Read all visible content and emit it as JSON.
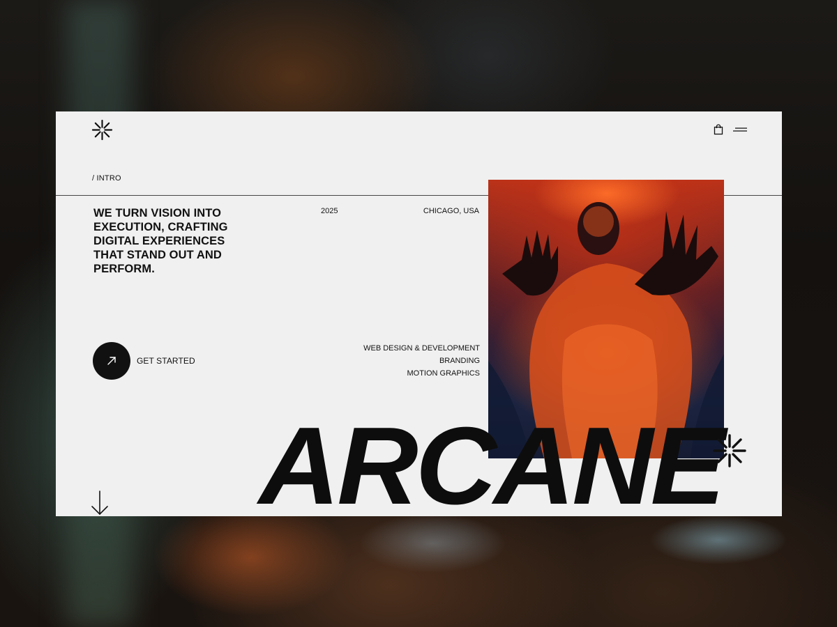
{
  "section_label": "/ INTRO",
  "headline": "WE TURN VISION INTO EXECUTION, CRAFTING DIGITAL EXPERIENCES THAT STAND OUT AND PERFORM.",
  "meta": {
    "year": "2025",
    "location": "CHICAGO, USA"
  },
  "services": [
    "WEB DESIGN & DEVELOPMENT",
    "BRANDING",
    "MOTION GRAPHICS"
  ],
  "cta": {
    "label": "GET STARTED",
    "icon": "arrow-up-right-icon"
  },
  "brand": {
    "wordmark": "ARCANE",
    "logo_icon": "asterisk-icon"
  },
  "header_icons": [
    "shopping-bag-icon",
    "menu-icon"
  ],
  "colors": {
    "panel": "#f0f0f0",
    "ink": "#111111",
    "accent": "#e0461b"
  }
}
